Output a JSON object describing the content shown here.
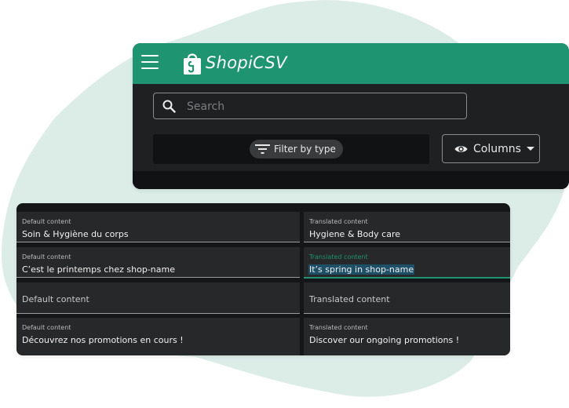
{
  "app": {
    "brand": "ShopiCSV",
    "search": {
      "placeholder": "Search",
      "value": ""
    },
    "filter": {
      "label": "Filter by type"
    },
    "columns": {
      "label": "Columns"
    }
  },
  "colors": {
    "brand": "#1f9470",
    "panel": "#1f2021",
    "selection": "#1d4f66",
    "blob": "#dcece7"
  },
  "icons": {
    "menu": "hamburger-icon",
    "logo": "shopping-bag-icon",
    "search": "search-icon",
    "filter": "filter-icon",
    "columns": "eye-icon",
    "dropdown": "caret-down-icon"
  },
  "rows": [
    {
      "left": {
        "label": "Default content",
        "value": "Soin & Hygiène du corps"
      },
      "right": {
        "label": "Translated content",
        "value": "Hygiene & Body care"
      }
    },
    {
      "left": {
        "label": "Default content",
        "value": "C’est le printemps chez shop-name"
      },
      "right": {
        "label": "Translated content",
        "value": "It’s spring in shop-name",
        "focused": true
      }
    },
    {
      "left": {
        "label": "Default content",
        "value": ""
      },
      "right": {
        "label": "Translated content",
        "value": ""
      }
    },
    {
      "left": {
        "label": "Default content",
        "value": "Découvrez nos promotions en cours !"
      },
      "right": {
        "label": "Translated content",
        "value": "Discover our ongoing promotions !"
      }
    }
  ]
}
